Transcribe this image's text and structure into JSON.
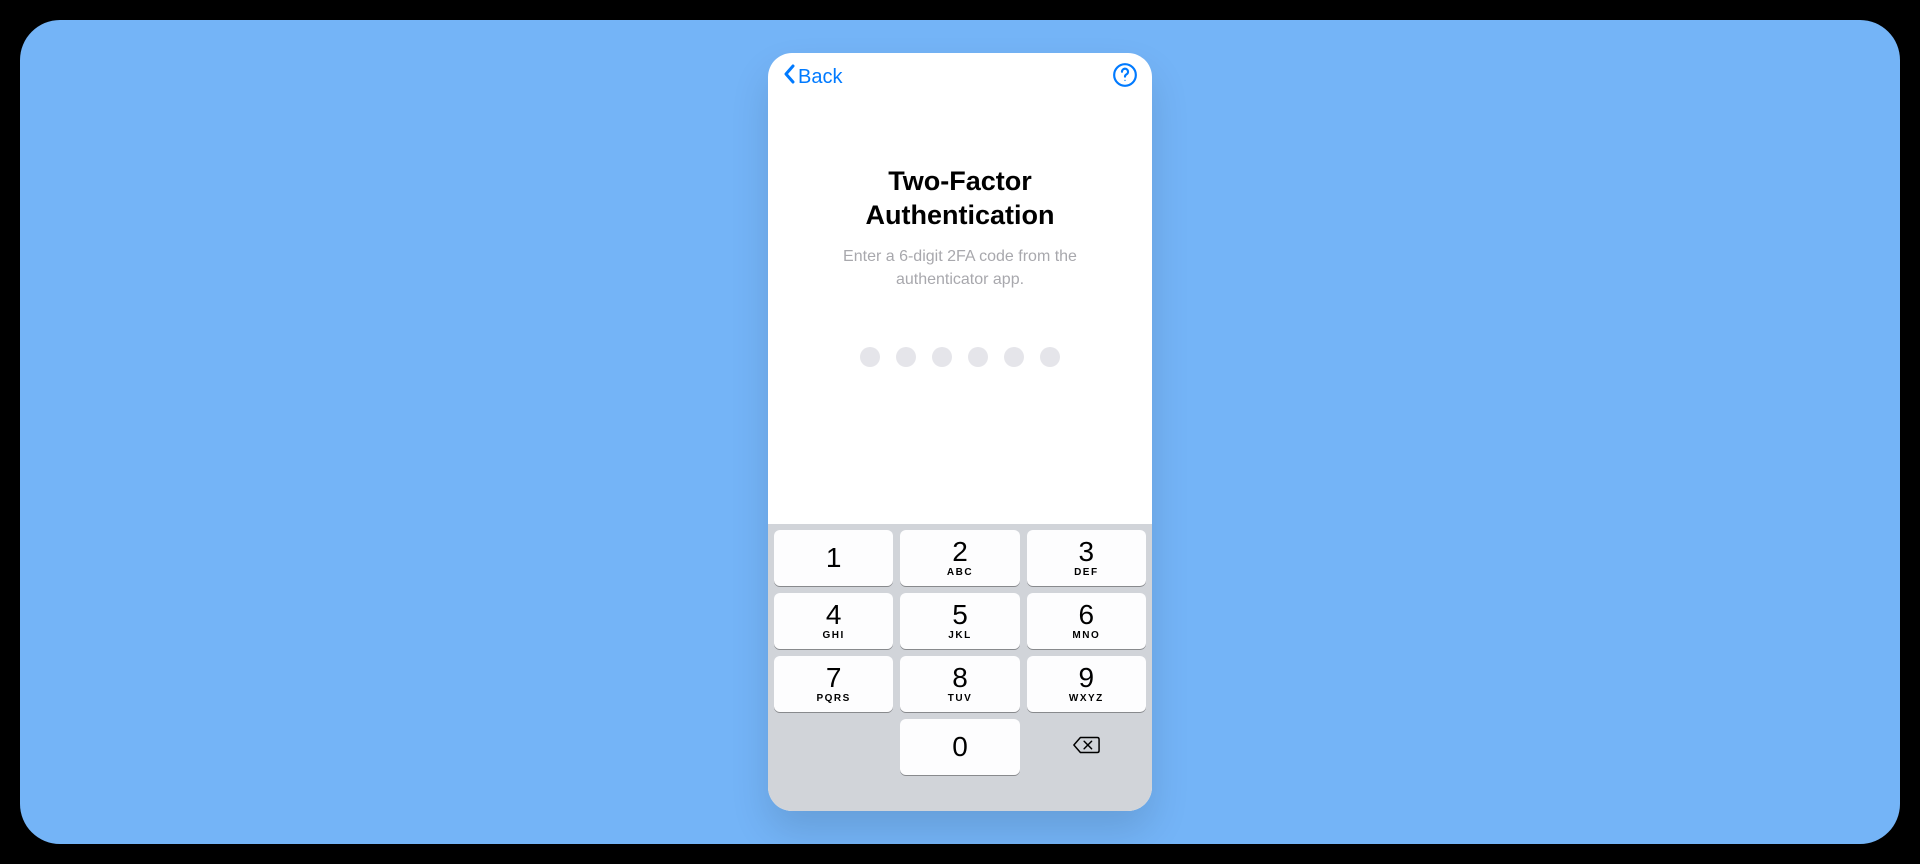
{
  "nav": {
    "back_label": "Back"
  },
  "screen": {
    "title": "Two-Factor Authentication",
    "subtitle": "Enter a 6-digit 2FA code from the authenticator app.",
    "code_length": 6,
    "entered": ""
  },
  "keypad": {
    "keys": [
      {
        "digit": "1",
        "letters": ""
      },
      {
        "digit": "2",
        "letters": "ABC"
      },
      {
        "digit": "3",
        "letters": "DEF"
      },
      {
        "digit": "4",
        "letters": "GHI"
      },
      {
        "digit": "5",
        "letters": "JKL"
      },
      {
        "digit": "6",
        "letters": "MNO"
      },
      {
        "digit": "7",
        "letters": "PQRS"
      },
      {
        "digit": "8",
        "letters": "TUV"
      },
      {
        "digit": "9",
        "letters": "WXYZ"
      },
      {
        "digit": "0",
        "letters": ""
      }
    ]
  },
  "colors": {
    "accent": "#007aff",
    "stage_bg": "#74b4f7"
  }
}
